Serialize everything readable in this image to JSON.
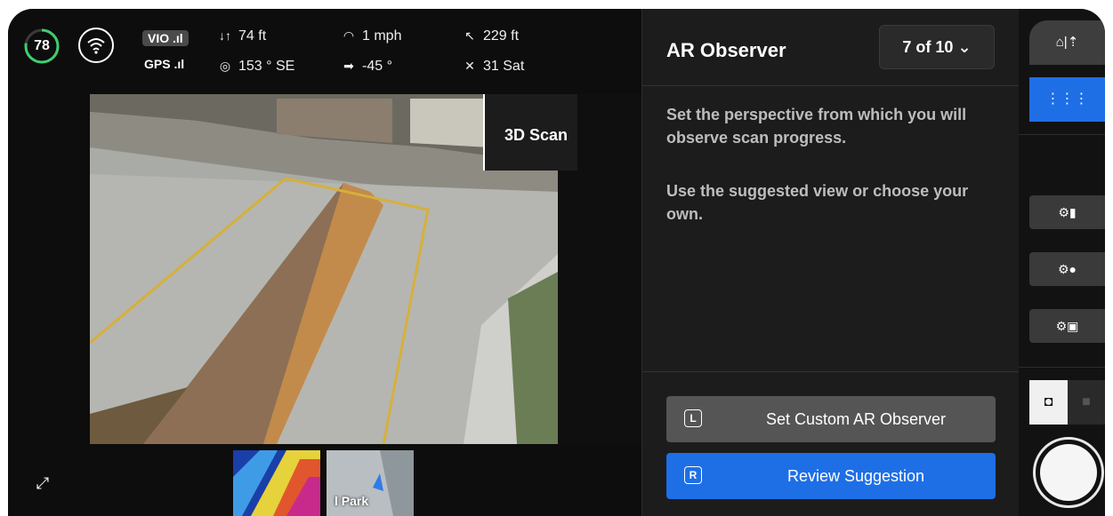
{
  "telemetry": {
    "battery": "78",
    "vio_label": "VIO .ıl",
    "gps_label": "GPS .ıl",
    "altitude": "74 ft",
    "heading": "153 ° SE",
    "speed": "1 mph",
    "gimbal_pitch": "-45 °",
    "distance": "229 ft",
    "satellites": "31 Sat"
  },
  "camera": {
    "mode_label": "3D Scan",
    "thumbnail_label": "l Park"
  },
  "panel": {
    "title": "AR Observer",
    "step": "7 of 10",
    "description_1": "Set the perspective from which you will observe scan progress.",
    "description_2": "Use the suggested view or choose your own.",
    "custom_button": {
      "key": "L",
      "label": "Set Custom AR Observer"
    },
    "review_button": {
      "key": "R",
      "label": "Review Suggestion"
    }
  },
  "colors": {
    "accent": "#1e6fe6",
    "battery_ring": "#3ecf6e"
  }
}
